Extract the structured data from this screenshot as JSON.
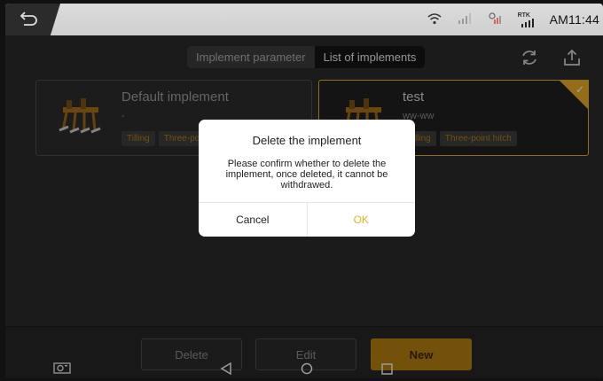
{
  "status": {
    "time": "AM11:44",
    "gnss_label": "RTK",
    "signal_icon": "signal-bars-icon"
  },
  "tabs": [
    {
      "label": "Implement parameter",
      "active": false
    },
    {
      "label": "List of implements",
      "active": true
    }
  ],
  "implements": [
    {
      "name": "Default implement",
      "subtitle": "-",
      "tags": [
        "Tilling",
        "Three-po"
      ],
      "selected": false
    },
    {
      "name": "test",
      "subtitle": "ww-ww",
      "tags": [
        "Tilling",
        "Three-point hitch"
      ],
      "selected": true
    }
  ],
  "dialog": {
    "title": "Delete the implement",
    "message": "Please confirm whether to delete the implement, once deleted, it cannot be withdrawed.",
    "cancel_label": "Cancel",
    "ok_label": "OK"
  },
  "actions": {
    "delete_label": "Delete",
    "edit_label": "Edit",
    "new_label": "New"
  },
  "colors": {
    "accent": "#e4a82a",
    "ok_text": "#e7b21a"
  }
}
